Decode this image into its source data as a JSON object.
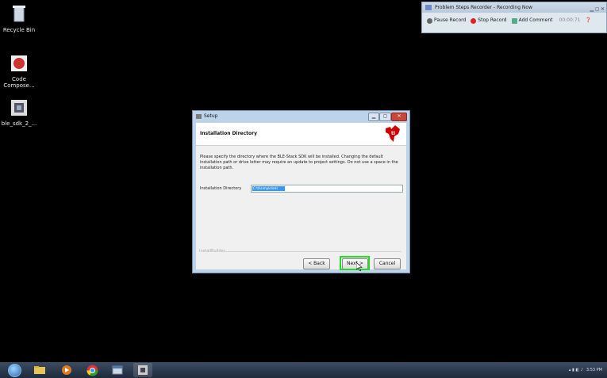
{
  "desktop": {
    "icons": [
      {
        "label": "Recycle Bin",
        "icon": "recycle-bin-icon"
      },
      {
        "label": "Code Compose...",
        "icon": "code-composer-icon"
      },
      {
        "label": "ble_sdk_2_...",
        "icon": "installer-icon"
      }
    ]
  },
  "psr": {
    "title": "Problem Steps Recorder - Recording Now",
    "pause_label": "Pause Record",
    "stop_label": "Stop Record",
    "comment_label": "Add Comment",
    "timer": "00:00:71"
  },
  "setup": {
    "title": "Setup",
    "header": "Installation Directory",
    "description": "Please specify the directory where the BLE-Stack SDK will be installed. Changing the default installation path or drive letter may require an update to project settings. Do not use a space in the installation path.",
    "dir_label": "Installation Directory",
    "dir_value": "C:\\ti\\simplelink\\",
    "brand": "InstallBuilder",
    "back_label": "< Back",
    "next_label": "Next >",
    "cancel_label": "Cancel"
  },
  "taskbar": {
    "clock": "3:53 PM",
    "items": [
      "start-orb-icon",
      "explorer-icon",
      "media-player-icon",
      "chrome-icon",
      "window-icon",
      "installer-icon"
    ]
  },
  "colors": {
    "highlight": "#22dd22",
    "ti_red": "#cc0000",
    "selection": "#3399ff"
  }
}
